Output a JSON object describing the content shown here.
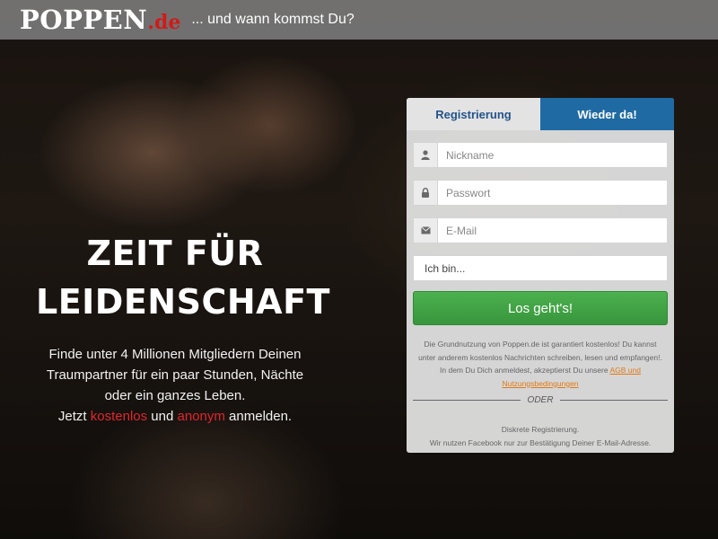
{
  "header": {
    "logo_main": "POPPEN",
    "logo_tld": ".de",
    "slogan": "... und wann kommst Du?"
  },
  "hero": {
    "headline_line1": "ZEIT FÜR",
    "headline_line2": "LEIDENSCHAFT",
    "text_line1": "Finde unter 4 Millionen Mitgliedern Deinen",
    "text_line2": "Traumpartner für ein paar Stunden, Nächte",
    "text_line3": "oder ein ganzes Leben.",
    "cta_prefix": "Jetzt",
    "cta_free": "kostenlos",
    "cta_and": "und",
    "cta_anon": "anonym",
    "cta_suffix": "anmelden."
  },
  "panel": {
    "tabs": [
      {
        "label": "Registrierung",
        "active": true
      },
      {
        "label": "Wieder da!",
        "active": false
      }
    ],
    "fields": {
      "nickname": {
        "placeholder": "Nickname",
        "icon": "user-icon"
      },
      "password": {
        "placeholder": "Passwort",
        "icon": "lock-icon"
      },
      "email": {
        "placeholder": "E-Mail",
        "icon": "envelope-icon"
      }
    },
    "gender_select": "Ich bin...",
    "submit_label": "Los geht's!",
    "legal_text": "Die Grundnutzung von Poppen.de ist garantiert kostenlos! Du kannst unter anderem kostenlos Nachrichten schreiben, lesen und empfangen!. In dem Du Dich anmeldest, akzeptierst Du unsere",
    "legal_link": "AGB und Nutzungsbedingungen",
    "divider_text": "ODER",
    "facebook_line1": "Diskrete Registrierung.",
    "facebook_line2": "Wir nutzen Facebook nur zur Bestätigung Deiner E-Mail-Adresse."
  },
  "colors": {
    "brand_red": "#d11a1a",
    "tab_blue": "#1f6aa3",
    "button_green": "#43a447"
  }
}
